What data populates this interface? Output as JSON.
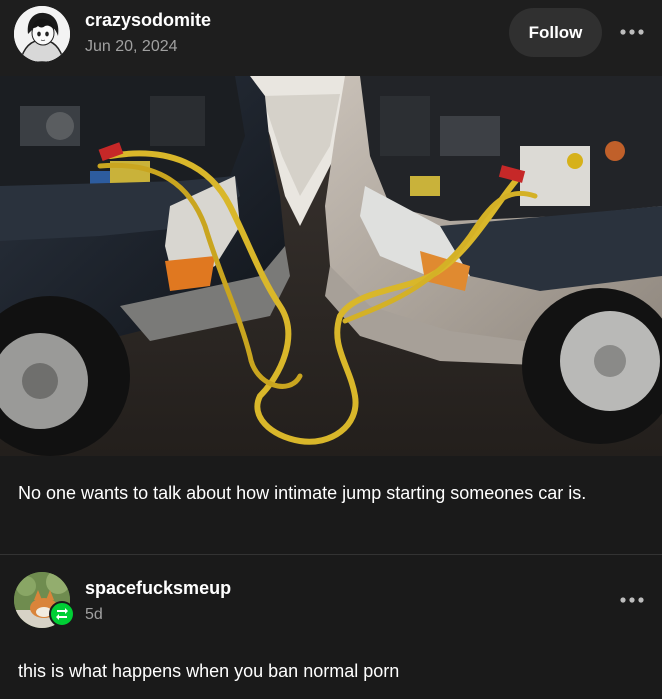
{
  "post": {
    "username": "crazysodomite",
    "date": "Jun 20, 2024",
    "follow_label": "Follow",
    "text": "No one wants to talk about how intimate jump starting someones car is."
  },
  "reblog": {
    "username": "spacefucksmeup",
    "time": "5d",
    "text": "this is what happens when you ban normal porn"
  },
  "icons": {
    "more": "more-options-icon",
    "reblog_badge": "reblog-icon",
    "avatar": "anime-avatar-icon"
  },
  "colors": {
    "background": "#1a1a1a",
    "header_background": "#1e1e1e",
    "follow_button": "#303030",
    "secondary_text": "#a0a0a0",
    "reblog_badge": "#00cf35"
  }
}
